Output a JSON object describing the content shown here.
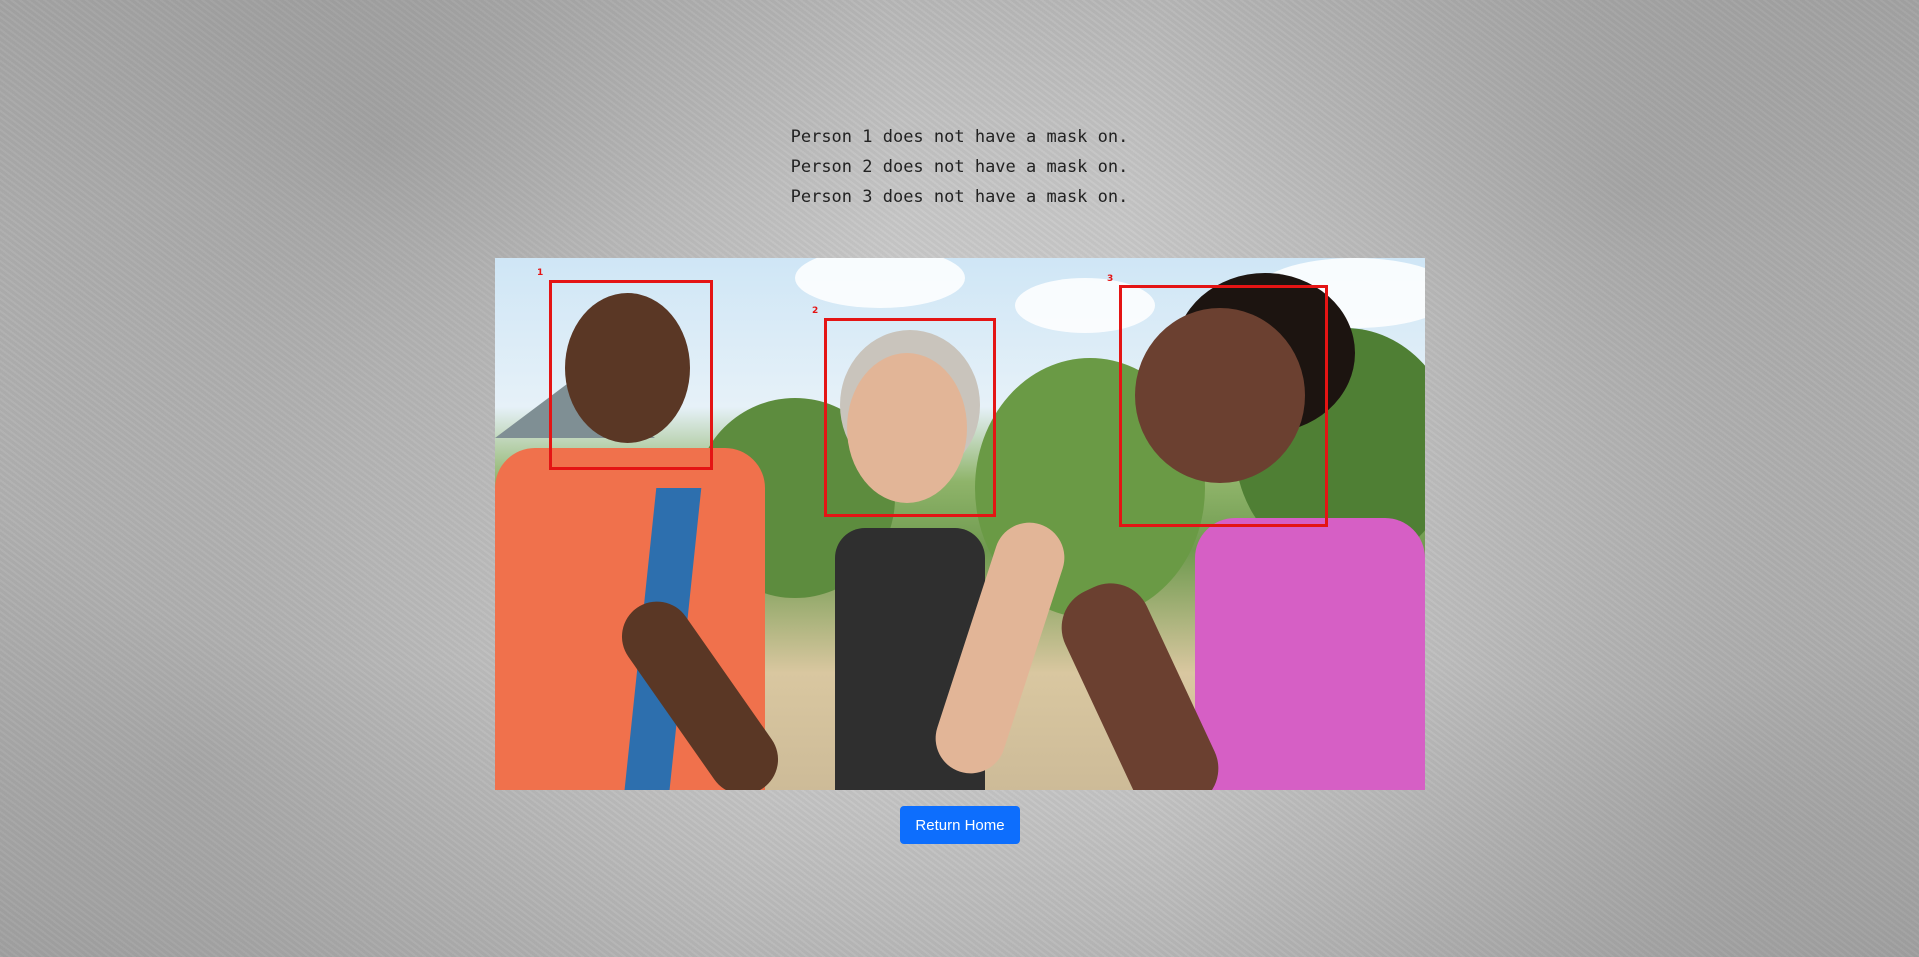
{
  "results": {
    "lines": [
      "Person 1 does not have a mask on.",
      "Person 2 does not have a mask on.",
      "Person 3 does not have a mask on."
    ]
  },
  "detections": [
    {
      "label": "1",
      "mask": false
    },
    {
      "label": "2",
      "mask": false
    },
    {
      "label": "3",
      "mask": false
    }
  ],
  "colors": {
    "box": "#e41414",
    "button": "#0d6efd"
  },
  "actions": {
    "return_label": "Return Home"
  }
}
